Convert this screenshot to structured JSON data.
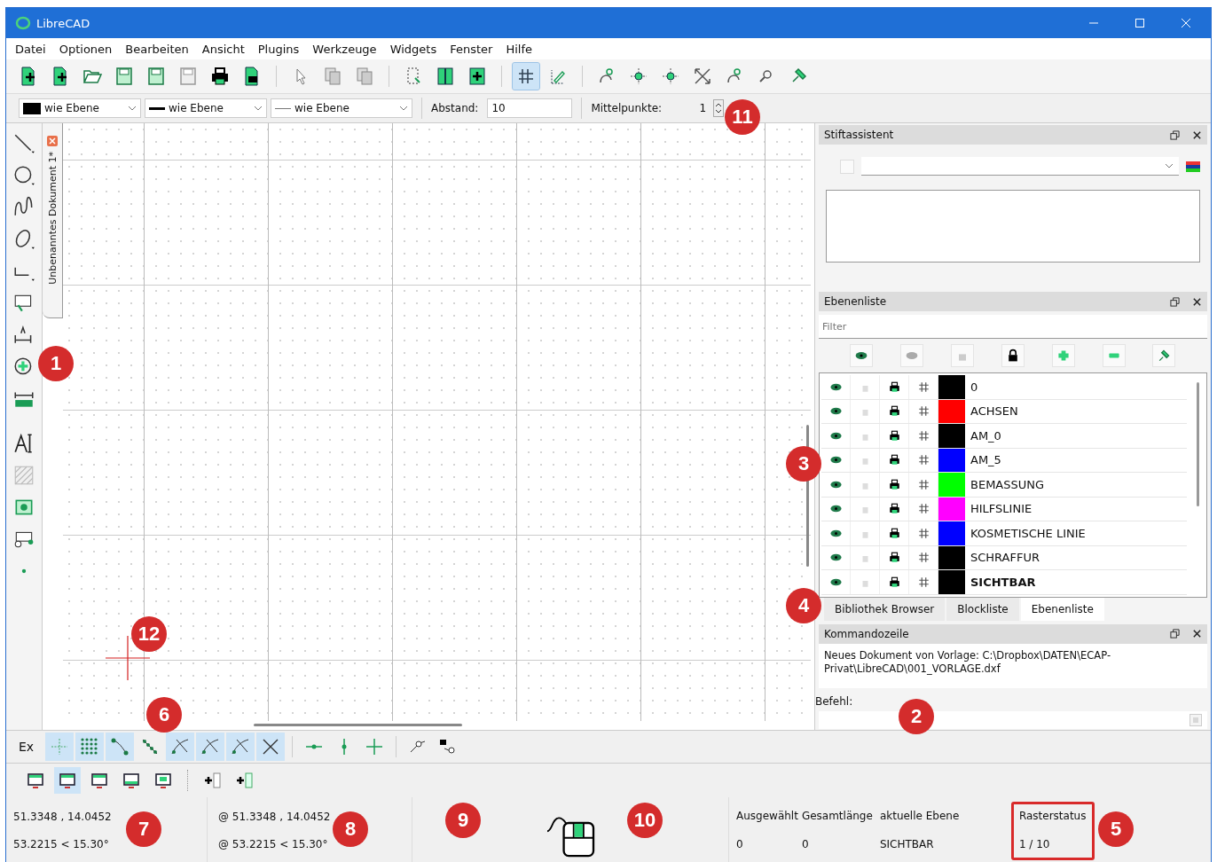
{
  "window": {
    "title": "LibreCAD"
  },
  "menu": [
    "Datei",
    "Optionen",
    "Bearbeiten",
    "Ansicht",
    "Plugins",
    "Werkzeuge",
    "Widgets",
    "Fenster",
    "Hilfe"
  ],
  "grid_button": {
    "on": true
  },
  "pen_toolbar": {
    "combos": [
      "wie Ebene",
      "wie Ebene",
      "wie Ebene"
    ],
    "distance_label": "Abstand:",
    "distance": "10",
    "midpoints_label": "Mittelpunkte:",
    "midpoints": "1"
  },
  "document_tab": {
    "title": "Unbenanntes Dokument 1*"
  },
  "pen_wizard": {
    "title": "Stiftassistent"
  },
  "layer_list": {
    "title": "Ebenenliste",
    "filter_placeholder": "Filter",
    "layers": [
      {
        "name": "0",
        "color": "#000000",
        "active": false
      },
      {
        "name": "ACHSEN",
        "color": "#ff0000",
        "active": false
      },
      {
        "name": "AM_0",
        "color": "#000000",
        "active": false
      },
      {
        "name": "AM_5",
        "color": "#0000ff",
        "active": false
      },
      {
        "name": "BEMASSUNG",
        "color": "#00ff00",
        "active": false
      },
      {
        "name": "HILFSLINIE",
        "color": "#ff00ff",
        "active": false
      },
      {
        "name": "KOSMETISCHE LINIE",
        "color": "#0000ff",
        "active": false
      },
      {
        "name": "SCHRAFFUR",
        "color": "#000000",
        "active": false
      },
      {
        "name": "SICHTBAR",
        "color": "#000000",
        "active": true
      }
    ]
  },
  "dock_tabs": [
    {
      "label": "Bibliothek Browser",
      "selected": false
    },
    {
      "label": "Blockliste",
      "selected": false
    },
    {
      "label": "Ebenenliste",
      "selected": true
    }
  ],
  "command_line": {
    "title": "Kommandozeile",
    "output": "Neues Dokument von Vorlage: C:\\Dropbox\\DATEN\\ECAP-Privat\\LibreCAD\\001_VORLAGE.dxf",
    "prompt_label": "Befehl:"
  },
  "snap_toolbar": {
    "label": "Ex",
    "snaps": [
      {
        "kind": "free",
        "on": true
      },
      {
        "kind": "grid",
        "on": true
      },
      {
        "kind": "endpoint",
        "on": true
      },
      {
        "kind": "entity",
        "on": false
      },
      {
        "kind": "center",
        "on": true
      },
      {
        "kind": "middle",
        "on": true
      },
      {
        "kind": "distance",
        "on": true
      },
      {
        "kind": "intersection",
        "on": true
      }
    ],
    "restrictions": [
      {
        "kind": "horizontal",
        "on": false
      },
      {
        "kind": "vertical",
        "on": false
      },
      {
        "kind": "orthogonal",
        "on": false
      },
      {
        "kind": "relzero",
        "on": false
      },
      {
        "kind": "lockzero",
        "on": false
      }
    ]
  },
  "view_toolbar": [
    {
      "on": false
    },
    {
      "on": true
    },
    {
      "on": false
    },
    {
      "on": false
    },
    {
      "on": false
    }
  ],
  "status_bar": {
    "absolute": [
      "51.3348 , 14.0452",
      "53.2215 < 15.30°"
    ],
    "relative": [
      "@  51.3348 , 14.0452",
      "@  53.2215 < 15.30°"
    ],
    "selected_label": "Ausgewählt",
    "selected": "0",
    "length_label": "Gesamtlänge",
    "length": "0",
    "layer_label": "aktuelle Ebene",
    "layer": "SICHTBAR",
    "grid_label": "Rasterstatus",
    "grid": "1 / 10",
    "grid_highlighted": true
  },
  "callouts": [
    {
      "label": "1"
    },
    {
      "label": "2"
    },
    {
      "label": "3"
    },
    {
      "label": "4"
    },
    {
      "label": "5"
    },
    {
      "label": "6"
    },
    {
      "label": "7"
    },
    {
      "label": "8"
    },
    {
      "label": "9"
    },
    {
      "label": "10"
    },
    {
      "label": "11"
    },
    {
      "label": "12"
    }
  ]
}
